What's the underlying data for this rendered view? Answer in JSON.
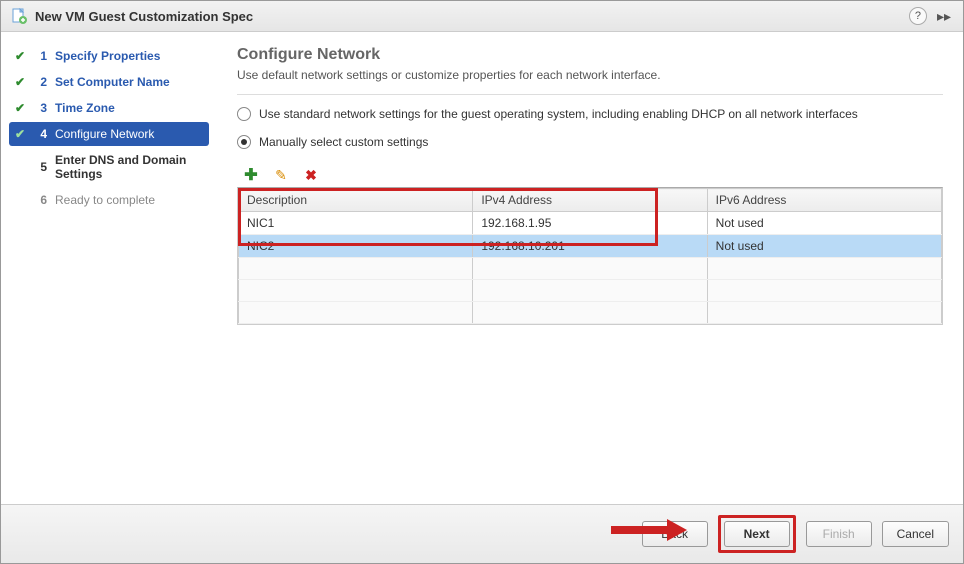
{
  "titlebar": {
    "title": "New VM Guest Customization Spec"
  },
  "sidebar": {
    "steps": [
      {
        "num": "1",
        "label": "Specify Properties"
      },
      {
        "num": "2",
        "label": "Set Computer Name"
      },
      {
        "num": "3",
        "label": "Time Zone"
      },
      {
        "num": "4",
        "label": "Configure Network"
      },
      {
        "num": "5",
        "label": "Enter DNS and Domain Settings"
      },
      {
        "num": "6",
        "label": "Ready to complete"
      }
    ]
  },
  "content": {
    "heading": "Configure Network",
    "subtitle": "Use default network settings or customize properties for each network interface.",
    "radio1": "Use standard network settings for the guest operating system, including enabling DHCP on all network interfaces",
    "radio2": "Manually select custom settings",
    "table": {
      "headers": {
        "description": "Description",
        "ipv4": "IPv4 Address",
        "ipv6": "IPv6 Address"
      },
      "rows": [
        {
          "desc": "NIC1",
          "ipv4": "192.168.1.95",
          "ipv6": "Not used"
        },
        {
          "desc": "NIC2",
          "ipv4": "192.168.10.201",
          "ipv6": "Not used"
        }
      ]
    }
  },
  "footer": {
    "back": "Back",
    "next": "Next",
    "finish": "Finish",
    "cancel": "Cancel"
  }
}
